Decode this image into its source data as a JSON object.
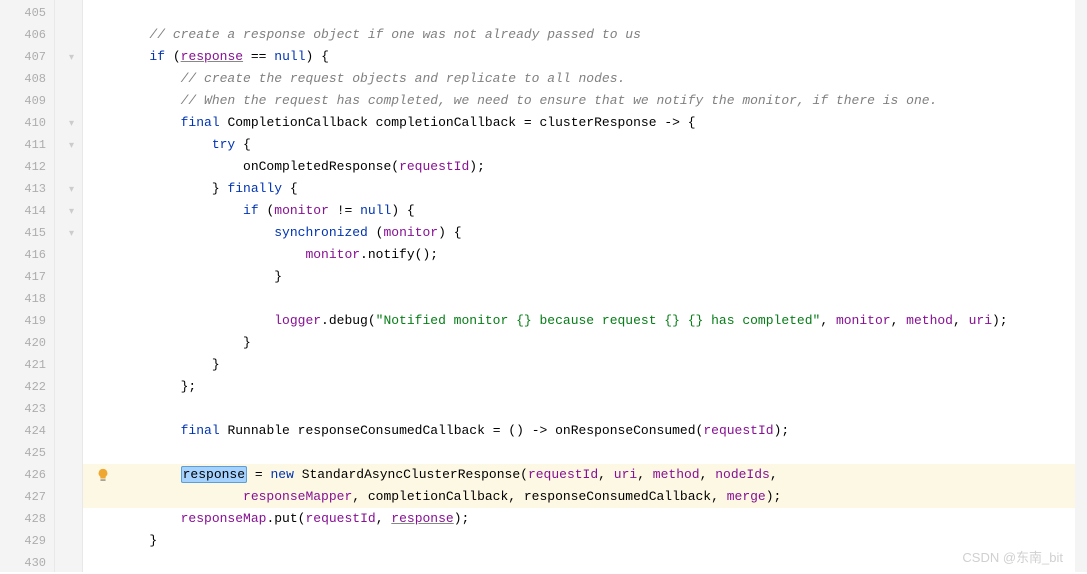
{
  "lines": [
    {
      "num": "405",
      "html": ""
    },
    {
      "num": "406",
      "html": "        <span class='comment'>// create a response object if one was not already passed to us</span>"
    },
    {
      "num": "407",
      "html": "        <span class='keyword'>if</span> (<span class='field underlined'>response</span> <span class='ident'>==</span> <span class='keyword'>null</span>) {"
    },
    {
      "num": "408",
      "html": "            <span class='comment'>// create the request objects and replicate to all nodes.</span>"
    },
    {
      "num": "409",
      "html": "            <span class='comment'>// When the request has completed, we need to ensure that we notify the monitor, if there is one.</span>"
    },
    {
      "num": "410",
      "html": "            <span class='keyword'>final</span> <span class='ident'>CompletionCallback completionCallback = clusterResponse -> {</span>"
    },
    {
      "num": "411",
      "html": "                <span class='keyword'>try</span> {"
    },
    {
      "num": "412",
      "html": "                    <span class='ident'>onCompletedResponse(</span><span class='field'>requestId</span><span class='ident'>);</span>"
    },
    {
      "num": "413",
      "html": "                } <span class='keyword'>finally</span> {"
    },
    {
      "num": "414",
      "html": "                    <span class='keyword'>if</span> <span class='ident'>(</span><span class='field'>monitor</span> <span class='ident'>!=</span> <span class='keyword'>null</span><span class='ident'>) {</span>"
    },
    {
      "num": "415",
      "html": "                        <span class='keyword'>synchronized</span> <span class='ident'>(</span><span class='field'>monitor</span><span class='ident'>) {</span>"
    },
    {
      "num": "416",
      "html": "                            <span class='field'>monitor</span><span class='ident'>.notify();</span>"
    },
    {
      "num": "417",
      "html": "                        <span class='ident'>}</span>"
    },
    {
      "num": "418",
      "html": ""
    },
    {
      "num": "419",
      "html": "                        <span class='field'>logger</span><span class='ident'>.debug(</span><span class='string'>\"Notified monitor {} because request {} {} has completed\"</span><span class='ident'>, </span><span class='field'>monitor</span><span class='ident'>, </span><span class='field'>method</span><span class='ident'>, </span><span class='field'>uri</span><span class='ident'>);</span>"
    },
    {
      "num": "420",
      "html": "                    <span class='ident'>}</span>"
    },
    {
      "num": "421",
      "html": "                <span class='ident'>}</span>"
    },
    {
      "num": "422",
      "html": "            <span class='ident'>};</span>"
    },
    {
      "num": "423",
      "html": ""
    },
    {
      "num": "424",
      "html": "            <span class='keyword'>final</span> <span class='ident'>Runnable responseConsumedCallback = () -> onResponseConsumed(</span><span class='field'>requestId</span><span class='ident'>);</span>"
    },
    {
      "num": "425",
      "html": ""
    },
    {
      "num": "426",
      "highlight": true,
      "bulb": true,
      "html": "            <span class='selected'>response</span> <span class='ident'>=</span> <span class='keyword'>new</span> <span class='ident'>StandardAsyncClusterResponse(</span><span class='field'>requestId</span><span class='ident'>, </span><span class='field'>uri</span><span class='ident'>, </span><span class='field'>method</span><span class='ident'>, </span><span class='field'>nodeIds</span><span class='ident'>,</span>"
    },
    {
      "num": "427",
      "highlight": true,
      "html": "                    <span class='field'>responseMapper</span><span class='ident'>, completionCallback, responseConsumedCallback, </span><span class='field'>merge</span><span class='ident'>);</span>"
    },
    {
      "num": "428",
      "html": "            <span class='field'>responseMap</span><span class='ident'>.put(</span><span class='field'>requestId</span><span class='ident'>, </span><span class='field underlined'>response</span><span class='ident'>);</span>"
    },
    {
      "num": "429",
      "html": "        <span class='ident'>}</span>"
    },
    {
      "num": "430",
      "html": ""
    }
  ],
  "watermark": "CSDN @东南_bit",
  "fold_markers": [
    407,
    410,
    411,
    413,
    414,
    415
  ]
}
